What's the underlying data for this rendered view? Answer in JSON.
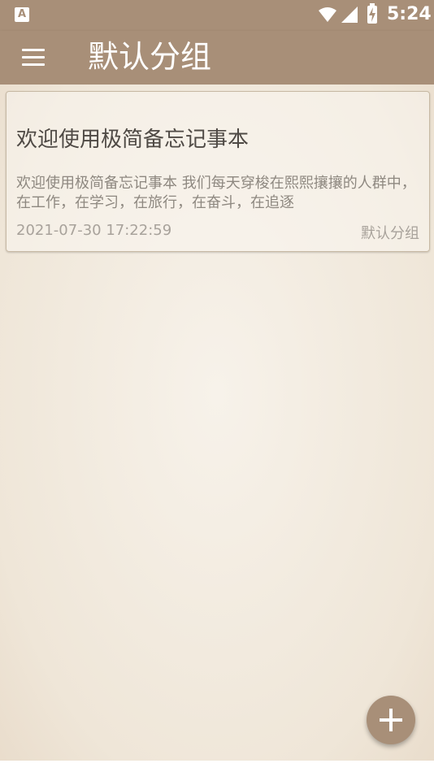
{
  "status_bar": {
    "notification_icon_letter": "A",
    "time": "5:24"
  },
  "app_bar": {
    "title": "默认分组",
    "menu_icon": "menu-icon"
  },
  "notes": [
    {
      "title": "欢迎使用极简备忘记事本",
      "preview": "欢迎使用极简备忘记事本 我们每天穿梭在熙熙攘攘的人群中，在工作，在学习，在旅行，在奋斗，在追逐",
      "date": "2021-07-30 17:22:59",
      "group": "默认分组"
    }
  ],
  "fab": {
    "icon": "plus-icon"
  },
  "colors": {
    "primary": "#a88f78",
    "background": "#f3ece2"
  }
}
